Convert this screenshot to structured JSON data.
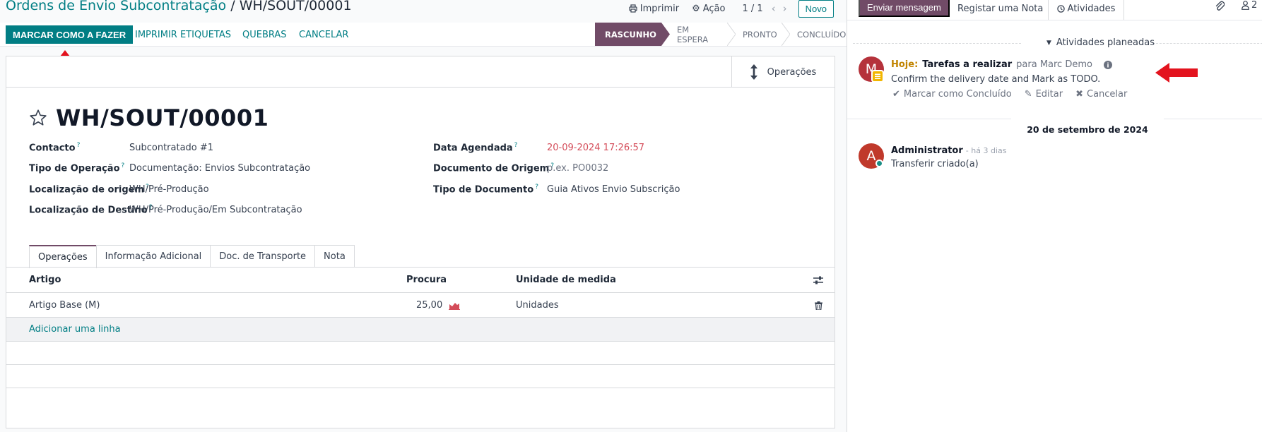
{
  "breadcrumb": {
    "parent": "Ordens de Envio Subcontratação",
    "separator": "/",
    "current": "WH/SOUT/00001"
  },
  "top_actions": {
    "print": "Imprimir",
    "action": "Ação",
    "pager": "1 / 1",
    "new": "Novo"
  },
  "toolbar": {
    "mark_todo": "MARCAR COMO A FAZER",
    "print_labels": "IMPRIMIR ETIQUETAS",
    "scrap": "QUEBRAS",
    "cancel": "CANCELAR"
  },
  "status_steps": [
    "RASCUNHO",
    "EM ESPERA",
    "PRONTO",
    "CONCLUÍDO"
  ],
  "status_active": "RASCUNHO",
  "smart_button": {
    "label": "Operações"
  },
  "record": {
    "name": "WH/SOUT/00001",
    "fields_left": [
      {
        "label": "Contacto",
        "value": "Subcontratado #1"
      },
      {
        "label": "Tipo de Operação",
        "value": "Documentação: Envios Subcontratação"
      },
      {
        "label": "Localização de origem",
        "value": "WH/Pré-Produção"
      },
      {
        "label": "Localização de Destino",
        "value": "WH/Pré-Produção/Em Subcontratação"
      }
    ],
    "fields_right": [
      {
        "label": "Data Agendada",
        "value": "20-09-2024 17:26:57"
      },
      {
        "label": "Documento de Origem",
        "value": "p.ex. PO0032"
      },
      {
        "label": "Tipo de Documento",
        "value": "Guia Ativos Envio Subscrição"
      }
    ],
    "help_mark": "?"
  },
  "tabs": [
    "Operações",
    "Informação Adicional",
    "Doc. de Transporte",
    "Nota"
  ],
  "table": {
    "headers": {
      "article": "Artigo",
      "demand": "Procura",
      "uom": "Unidade de medida"
    },
    "rows": [
      {
        "article": "Artigo Base (M)",
        "demand": "25,00",
        "uom": "Unidades"
      }
    ],
    "add_line": "Adicionar uma linha"
  },
  "chatter": {
    "send_message": "Enviar mensagem",
    "log_note": "Registar uma Nota",
    "activities": "Atividades",
    "followers_count": "2",
    "planned_header": "Atividades planeadas",
    "activity": {
      "avatar_letter": "M",
      "due": "Hoje:",
      "summary": "Tarefas a realizar",
      "for": "para Marc Demo",
      "note": "Confirm the delivery date and Mark as TODO.",
      "mark_done": "Marcar como Concluído",
      "edit": "Editar",
      "cancel": "Cancelar"
    },
    "date_separator": "20 de setembro de 2024",
    "message": {
      "avatar_letter": "A",
      "author": "Administrator",
      "time": "- há 3 dias",
      "body": "Transferir criado(a)"
    }
  },
  "colors": {
    "primary": "#017e84",
    "brand": "#714b67",
    "danger": "#d44c59",
    "annotation_arrow": "#e3131e"
  }
}
